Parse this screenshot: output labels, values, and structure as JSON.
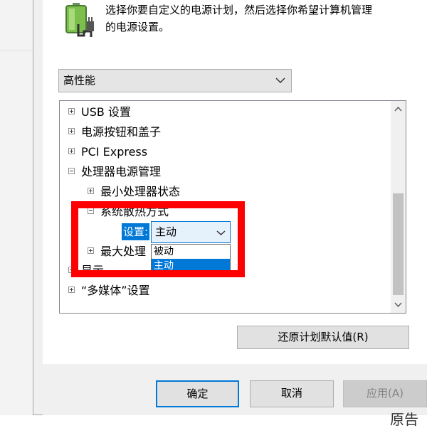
{
  "intro": {
    "line1": "选择你要自定义的电源计划，然后选择你希望计算机管理",
    "line2": "的电源设置。"
  },
  "plan_select": {
    "value": "高性能"
  },
  "tree": {
    "items": [
      {
        "label": "USB 设置"
      },
      {
        "label": "电源按钮和盖子"
      },
      {
        "label": "PCI Express"
      },
      {
        "label": "处理器电源管理"
      },
      {
        "label": "最小处理器状态"
      },
      {
        "label": "系统散热方式"
      },
      {
        "label": "最大处理"
      },
      {
        "label": "显示"
      },
      {
        "label": "“多媒体”设置"
      }
    ]
  },
  "setting": {
    "label": "设置:",
    "value": "主动",
    "options": [
      "被动",
      "主动"
    ]
  },
  "buttons": {
    "restore": "还原计划默认值(R)",
    "ok": "确定",
    "cancel": "取消",
    "apply": "应用(A)"
  },
  "corner_text": "原告"
}
